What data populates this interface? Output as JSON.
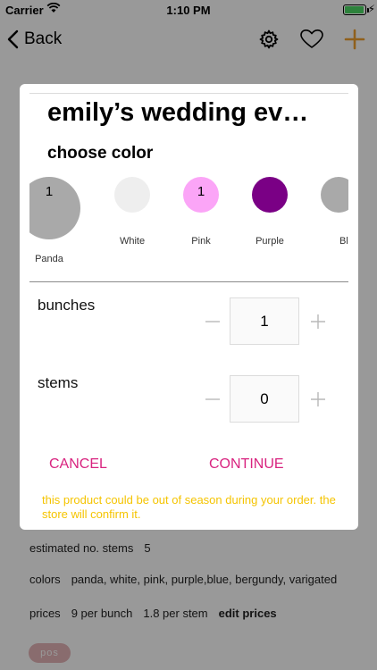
{
  "status_bar": {
    "carrier": "Carrier",
    "time": "1:10 PM",
    "charge_glyph": "⚡"
  },
  "nav": {
    "back_label": "Back"
  },
  "colors": {
    "accent": "#d8237f",
    "nav_plus": "#f0a030",
    "warning": "#f5c400"
  },
  "product": {
    "estimated_stems_label": "estimated no. stems",
    "estimated_stems_value": "5",
    "colors_label": "colors",
    "colors_value": "panda, white, pink, purple,blue, bergundy, varigated",
    "prices_label": "prices",
    "price_per_bunch": "9 per bunch",
    "price_per_stem": "1.8 per stem",
    "edit_prices_label": "edit prices",
    "badge": "pos"
  },
  "modal": {
    "title": "emily’s wedding ev…",
    "subtitle": "choose color",
    "swatches": [
      {
        "name": "Panda",
        "color": "#a9a9a9",
        "count": "1"
      },
      {
        "name": "White",
        "color": "#eeeeee",
        "count": ""
      },
      {
        "name": "Pink",
        "color": "#fba5f7",
        "count": "1"
      },
      {
        "name": "Purple",
        "color": "#7a0085",
        "count": ""
      },
      {
        "name": "Blue",
        "color": "#a9a9a9",
        "count": ""
      }
    ],
    "bunches": {
      "label": "bunches",
      "value": "1"
    },
    "stems": {
      "label": "stems",
      "value": "0"
    },
    "cancel_label": "CANCEL",
    "continue_label": "CONTINUE",
    "note": "this product could be out of season during your order. the store will confirm it."
  }
}
